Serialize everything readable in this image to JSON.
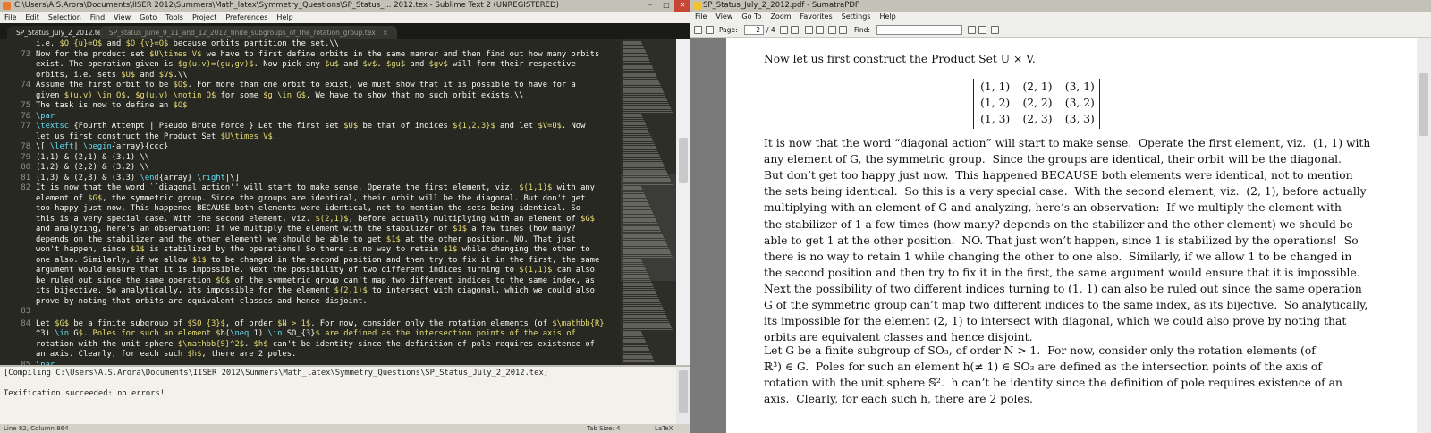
{
  "sublime": {
    "title": "C:\\Users\\A.S.Arora\\Documents\\IISER 2012\\Summers\\Math_latex\\Symmetry_Questions\\SP_Status_... 2012.tex - Sublime Text 2 (UNREGISTERED)",
    "menu": [
      "File",
      "Edit",
      "Selection",
      "Find",
      "View",
      "Goto",
      "Tools",
      "Project",
      "Preferences",
      "Help"
    ],
    "tabs": [
      {
        "label": "SP_Status_July_2_2012.tex",
        "active": true
      },
      {
        "label": "SP_status_June_9_11_and_12_2012_finite_subgroups_of_the_rotation_group.tex",
        "active": false
      }
    ],
    "lines": [
      {
        "n": "",
        "t": "i.e. $O_{u}=O$ and $O_{v}=O$ because orbits partition the set.\\\\"
      },
      {
        "n": "73",
        "t": "Now for the product set $U\\times V$ we have to first define orbits in the same manner and then find out how many orbits"
      },
      {
        "n": "",
        "t": "exist. The operation given is $g(u,v)=(gu,gv)$. Now pick any $u$ and $v$. $gu$ and $gv$ will form their respective"
      },
      {
        "n": "",
        "t": "orbits, i.e. sets $U$ and $V$.\\\\"
      },
      {
        "n": "74",
        "t": "Assume the first orbit to be $O$. For more than one orbit to exist, we must show that it is possible to have for a"
      },
      {
        "n": "",
        "t": "given $(u,v) \\in O$, $g(u,v) \\notin O$ for some $g \\in G$. We have to show that no such orbit exists.\\\\"
      },
      {
        "n": "75",
        "t": "The task is now to define an $O$"
      },
      {
        "n": "76",
        "t": "\\par"
      },
      {
        "n": "77",
        "t": "\\textsc {Fourth Attempt | Pseudo Brute Force } Let the first set $U$ be that of indices ${1,2,3}$ and let $V=U$. Now"
      },
      {
        "n": "",
        "t": "let us first construct the Product Set $U\\times V$."
      },
      {
        "n": "78",
        "t": "\\[ \\left| \\begin{array}{ccc}"
      },
      {
        "n": "79",
        "t": "(1,1) & (2,1) & (3,1) \\\\"
      },
      {
        "n": "80",
        "t": "(1,2) & (2,2) & (3,2) \\\\"
      },
      {
        "n": "81",
        "t": "(1,3) & (2,3) & (3,3) \\end{array} \\right|\\]"
      },
      {
        "n": "82",
        "t": "It is now that the word ``diagonal action'' will start to make sense. Operate the first element, viz. $(1,1)$ with any"
      },
      {
        "n": "",
        "t": "element of $G$, the symmetric group. Since the groups are identical, their orbit will be the diagonal. But don't get"
      },
      {
        "n": "",
        "t": "too happy just now. This happened BECAUSE both elements were identical, not to mention the sets being identical. So"
      },
      {
        "n": "",
        "t": "this is a very special case. With the second element, viz. $(2,1)$, before actually multiplying with an element of $G$"
      },
      {
        "n": "",
        "t": "and analyzing, here's an observation: If we multiply the element with the stabilizer of $1$ a few times (how many?"
      },
      {
        "n": "",
        "t": "depends on the stabilizer and the other element) we should be able to get $1$ at the other position. NO. That just"
      },
      {
        "n": "",
        "t": "won't happen, since $1$ is stabilized by the operations! So there is no way to retain $1$ while changing the other to"
      },
      {
        "n": "",
        "t": "one also. Similarly, if we allow $1$ to be changed in the second position and then try to fix it in the first, the same"
      },
      {
        "n": "",
        "t": "argument would ensure that it is impossible. Next the possibility of two different indices turning to $(1,1)$ can also"
      },
      {
        "n": "",
        "t": "be ruled out since the same operation $G$ of the symmetric group can't map two different indices to the same index, as"
      },
      {
        "n": "",
        "t": "its bijective. So analytically, its impossible for the element $(2,1)$ to intersect with diagonal, which we could also"
      },
      {
        "n": "",
        "t": "prove by noting that orbits are equivalent classes and hence disjoint."
      },
      {
        "n": "83",
        "t": ""
      },
      {
        "n": "84",
        "t": "Let $G$ be a finite subgroup of $SO_{3}$, of order $N > 1$. For now, consider only the rotation elements (of $\\mathbb{R}"
      },
      {
        "n": "",
        "t": "^3) \\in G$. Poles for such an element $h(\\neq 1) \\in SO_{3}$ are defined as the intersection points of the axis of"
      },
      {
        "n": "",
        "t": "rotation with the unit sphere $\\mathbb{S}^2$. $h$ can't be identity since the definition of pole requires existence of"
      },
      {
        "n": "",
        "t": "an axis. Clearly, for each such $h$, there are 2 poles."
      },
      {
        "n": "85",
        "t": "\\par"
      }
    ],
    "console": [
      "[Compiling C:\\Users\\A.S.Arora\\Documents\\IISER 2012\\Summers\\Math_latex\\Symmetry_Questions\\SP_Status_July_2_2012.tex]",
      "",
      "Texification succeeded: no errors!"
    ],
    "status": {
      "position": "Line 82, Column 864",
      "tab_size": "Tab Size: 4",
      "syntax": "LaTeX"
    }
  },
  "sumatra": {
    "title": "SP_Status_July_2_2012.pdf - SumatraPDF",
    "menu": [
      "File",
      "View",
      "Go To",
      "Zoom",
      "Favorites",
      "Settings",
      "Help"
    ],
    "toolbar": {
      "page_label": "Page:",
      "page_value": "2",
      "page_total": "/ 4",
      "find_label": "Find:",
      "find_value": ""
    },
    "page_lines": [
      "Now let us first construct the Product Set U × V.",
      "It is now that the word “diagonal action” will start to make sense.  Operate the first element, viz.  (1, 1) with",
      "any element of G, the symmetric group.  Since the groups are identical, their orbit will be the diagonal.",
      "But don’t get too happy just now.  This happened BECAUSE both elements were identical, not to mention",
      "the sets being identical.  So this is a very special case.  With the second element, viz.  (2, 1), before actually",
      "multiplying with an element of G and analyzing, here’s an observation:  If we multiply the element with",
      "the stabilizer of 1 a few times (how many? depends on the stabilizer and the other element) we should be",
      "able to get 1 at the other position.  NO. That just won’t happen, since 1 is stabilized by the operations!  So",
      "there is no way to retain 1 while changing the other to one also.  Similarly, if we allow 1 to be changed in",
      "the second position and then try to fix it in the first, the same argument would ensure that it is impossible.",
      "Next the possibility of two different indices turning to (1, 1) can also be ruled out since the same operation",
      "G of the symmetric group can’t map two different indices to the same index, as its bijective.  So analytically,",
      "its impossible for the element (2, 1) to intersect with diagonal, which we could also prove by noting that",
      "orbits are equivalent classes and hence disjoint.",
      "Let G be a finite subgroup of SO₃, of order N > 1.  For now, consider only the rotation elements (of",
      "ℝ³) ∈ G.  Poles for such an element h(≠ 1) ∈ SO₃ are defined as the intersection points of the axis of",
      "rotation with the unit sphere 𝕊².  h can’t be identity since the definition of pole requires existence of an",
      "axis.  Clearly, for each such h, there are 2 poles."
    ],
    "matrix": [
      [
        "(1, 1)",
        "(2, 1)",
        "(3, 1)"
      ],
      [
        "(1, 2)",
        "(2, 2)",
        "(3, 2)"
      ],
      [
        "(1, 3)",
        "(2, 3)",
        "(3, 3)"
      ]
    ]
  }
}
